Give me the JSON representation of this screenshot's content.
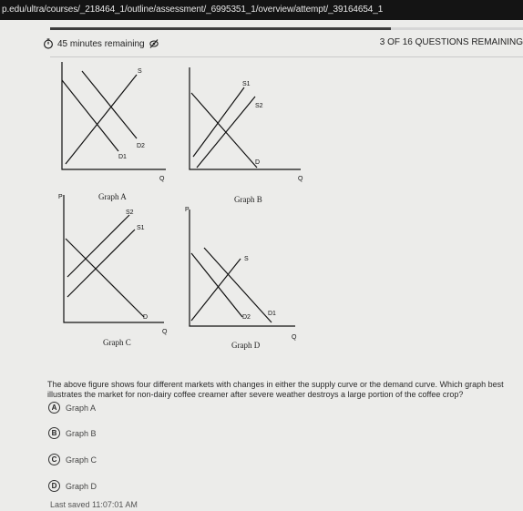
{
  "browser": {
    "url": "p.edu/ultra/courses/_218464_1/outline/assessment/_6995351_1/overview/attempt/_39164654_1"
  },
  "header": {
    "timer_text": "45 minutes remaining",
    "timer_icon": "stopwatch-icon",
    "hide_icon": "eye-slash-icon",
    "question_counter": "3 OF 16 QUESTIONS REMAINING",
    "progress_fraction": 0.72
  },
  "graphs": {
    "a": {
      "caption": "Graph A",
      "axis_x": "Q",
      "label_s": "S",
      "label_d1": "D1",
      "label_d2": "D2"
    },
    "b": {
      "caption": "Graph B",
      "axis_x": "Q",
      "label_s1": "S1",
      "label_s2": "S2",
      "label_d": "D"
    },
    "c": {
      "caption": "Graph C",
      "axis_y": "P",
      "axis_x": "Q",
      "label_s2": "S2",
      "label_s1": "S1",
      "label_d": "D"
    },
    "d": {
      "caption": "Graph D",
      "axis_y": "P",
      "axis_x": "Q",
      "label_s": "S",
      "label_d2": "D2",
      "label_d1": "D1"
    }
  },
  "question": {
    "text": "The above figure shows four different markets with changes in either the supply curve or the demand curve. Which graph best illustrates the market for non-dairy coffee creamer after severe weather destroys a large portion of the coffee crop?"
  },
  "options": [
    {
      "letter": "A",
      "label": "Graph A"
    },
    {
      "letter": "B",
      "label": "Graph B"
    },
    {
      "letter": "C",
      "label": "Graph C"
    },
    {
      "letter": "D",
      "label": "Graph D"
    }
  ],
  "footer": {
    "last_saved": "Last saved 11:07:01 AM"
  }
}
